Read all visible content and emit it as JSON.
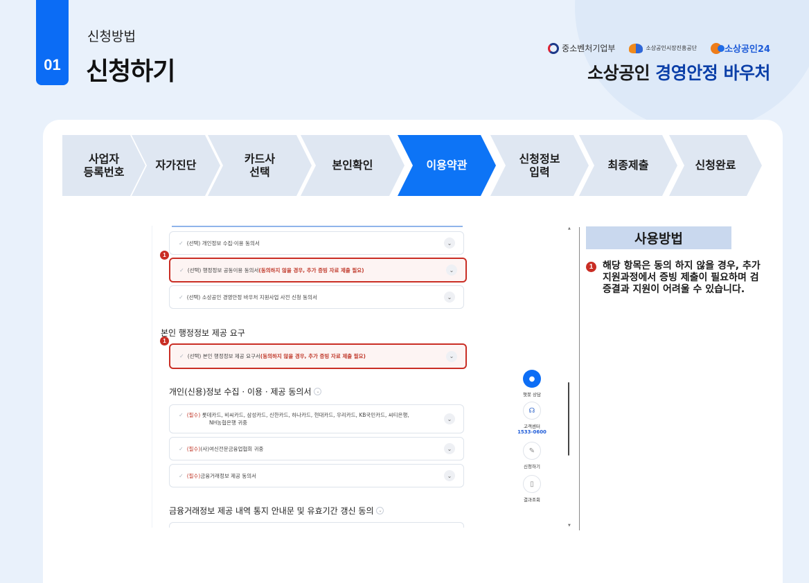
{
  "header": {
    "number": "01",
    "subtitle": "신청방법",
    "title": "신청하기",
    "logos": [
      "중소벤처기업부",
      "소상공인시장진흥공단",
      "소상공인24"
    ],
    "brand_prefix": "소상공인 ",
    "brand_highlight": "경영안정 바우처"
  },
  "steps": [
    "사업자\n등록번호",
    "자가진단",
    "카드사\n선택",
    "본인확인",
    "이용약관",
    "신청정보\n입력",
    "최종제출",
    "신청완료"
  ],
  "active_step": "이용약관",
  "terms": {
    "row1": {
      "prefix": "(선택) 개인정보 수집·이용 동의서"
    },
    "row2": {
      "prefix": "(선택) 행정정보 공동이용 동의서 ",
      "warning": "(동의하지 않을 경우, 추가 증빙 자료 제출 필요)"
    },
    "row3": {
      "prefix": "(선택) 소상공인 경영안정 바우처 지원사업 사전 신청 동의서"
    },
    "section2_heading": "본인 행정정보 제공 요구",
    "row4": {
      "prefix": "(선택) 본인 행정정보 제공 요구서 ",
      "warning": "(동의하지 않을 경우, 추가 증빙 자료 제출 필요)"
    },
    "section3_heading": "개인(신용)정보 수집 · 이용 · 제공 동의서",
    "row5": {
      "req": "(필수)",
      "text": " 롯데카드, 비씨카드, 삼성카드, 신한카드, 하나카드, 현대카드, 우리카드, KB국민카드, 씨티은행,",
      "text2": "NH농협은행 귀중"
    },
    "row6": {
      "req": "(필수)",
      "text": " (사)여신전문금융업협회 귀중"
    },
    "row7": {
      "req": "(필수)",
      "text": " 금융거래정보 제공 동의서"
    },
    "section4_heading": "금융거래정보 제공 내역 통지 안내문 및 유효기간 갱신 동의",
    "badge": "1"
  },
  "widgets": {
    "chatbot": "챗봇 상담",
    "callcenter": "고객센터",
    "phone": "1533-0600",
    "apply": "신청하기",
    "result": "결과조회"
  },
  "usage": {
    "title": "사용방법",
    "badge": "1",
    "text": "해당 항목은 동의 하지 않을 경우, 추가 지원과정에서 증빙 제출이 필요하며 검증결과 지원이 어려울 수 있습니다."
  },
  "colors": {
    "accent": "#0d74f6",
    "warning": "#c92d24",
    "step_inactive": "#dfe7f2",
    "usage_bg": "#c9d8ee"
  }
}
